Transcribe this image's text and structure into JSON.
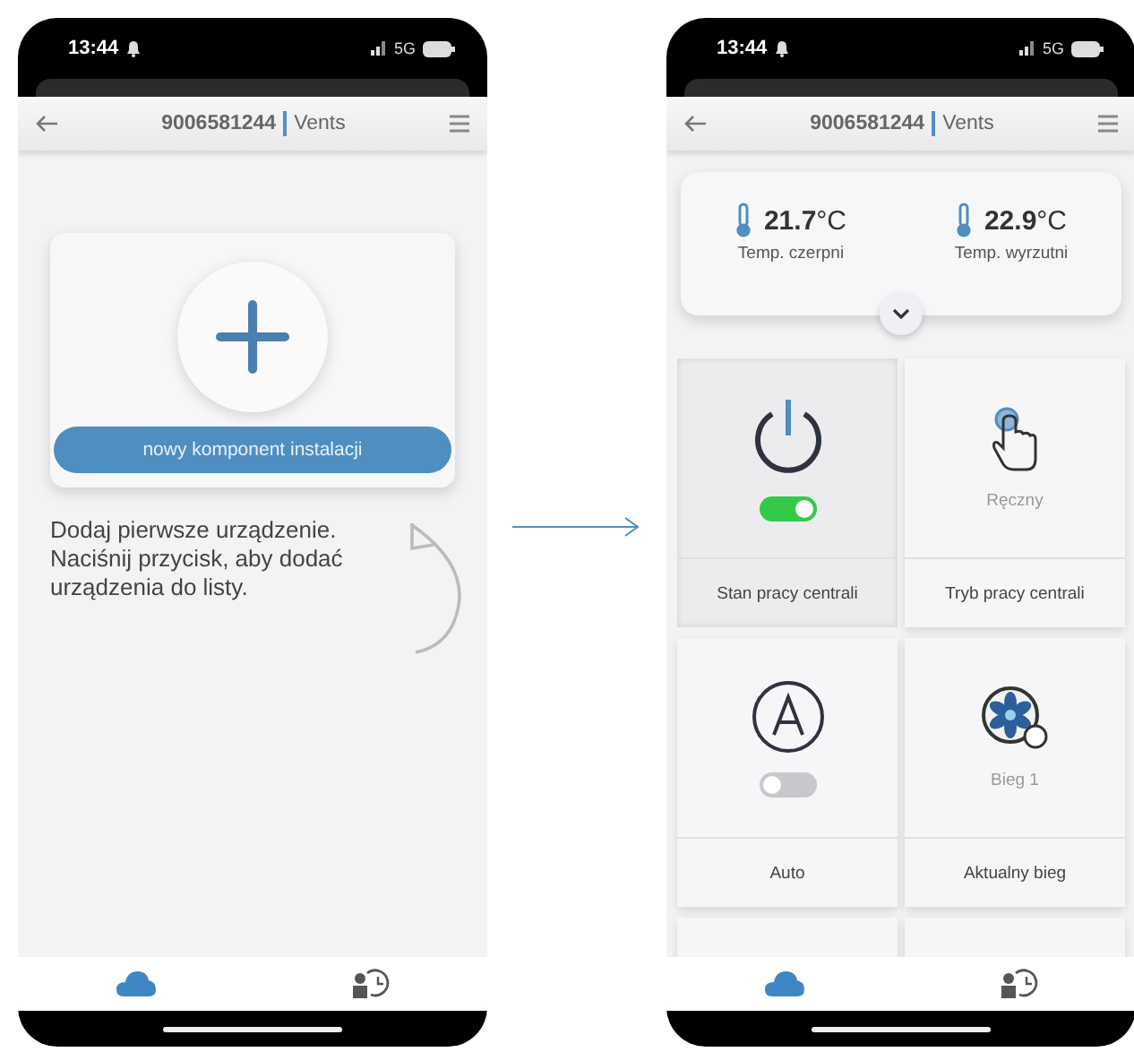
{
  "screens": [
    {
      "status_bar": {
        "time": "13:44",
        "network": "5G"
      },
      "header": {
        "device_id": "9006581244",
        "brand": "Vents"
      },
      "kind": "empty",
      "add_button": {
        "label": "nowy komponent instalacji"
      },
      "hint": "Dodaj pierwsze urządzenie. Naciśnij przycisk, aby dodać urządzenia do listy.",
      "bottom_nav": [
        {
          "selected": true
        },
        {
          "selected": false
        }
      ]
    },
    {
      "status_bar": {
        "time": "13:44",
        "network": "5G"
      },
      "header": {
        "device_id": "9006581244",
        "brand": "Vents"
      },
      "kind": "dashboard",
      "temperatures": [
        {
          "value": "**21.7**°C",
          "label": "Temp. czerpni"
        },
        {
          "value": "**22.9**°C",
          "label": "Temp. wyrzutni"
        }
      ],
      "tiles": [
        {
          "kind": "switch",
          "on": true,
          "label": "Stan pracy centrali",
          "selected": true
        },
        {
          "kind": "value",
          "value": "Ręczny",
          "label": "Tryb pracy centrali",
          "selected": false
        },
        {
          "kind": "switch",
          "on": false,
          "label": "Auto",
          "selected": false
        },
        {
          "kind": "value",
          "value": "Bieg 1",
          "label": "Aktualny bieg",
          "selected": false
        }
      ],
      "bottom_nav": [
        {
          "selected": true
        },
        {
          "selected": false
        }
      ]
    }
  ]
}
